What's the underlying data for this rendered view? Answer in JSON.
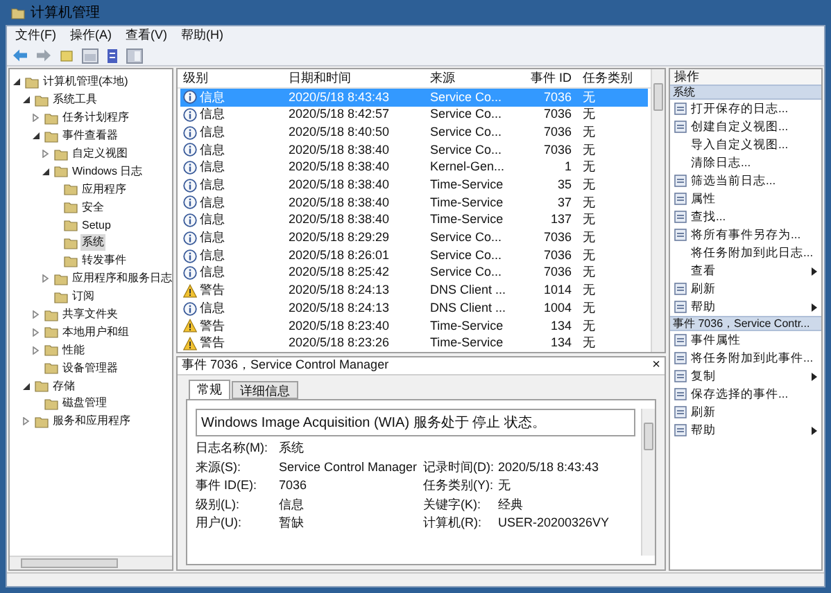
{
  "window": {
    "title": "计算机管理"
  },
  "menu": [
    "文件(F)",
    "操作(A)",
    "查看(V)",
    "帮助(H)"
  ],
  "tree": [
    {
      "label": "计算机管理(本地)",
      "expanded": true,
      "selected": false,
      "children": [
        {
          "label": "系统工具",
          "expanded": true,
          "selected": false,
          "children": [
            {
              "label": "任务计划程序",
              "expanded": false,
              "selected": false
            },
            {
              "label": "事件查看器",
              "expanded": true,
              "selected": false,
              "children": [
                {
                  "label": "自定义视图",
                  "expanded": false,
                  "selected": false
                },
                {
                  "label": "Windows 日志",
                  "expanded": true,
                  "selected": false,
                  "children": [
                    {
                      "label": "应用程序",
                      "selected": false
                    },
                    {
                      "label": "安全",
                      "selected": false
                    },
                    {
                      "label": "Setup",
                      "selected": false
                    },
                    {
                      "label": "系统",
                      "selected": true
                    },
                    {
                      "label": "转发事件",
                      "selected": false
                    }
                  ]
                },
                {
                  "label": "应用程序和服务日志",
                  "expanded": false,
                  "selected": false
                },
                {
                  "label": "订阅",
                  "selected": false
                }
              ]
            },
            {
              "label": "共享文件夹",
              "expanded": false,
              "selected": false
            },
            {
              "label": "本地用户和组",
              "expanded": false,
              "selected": false
            },
            {
              "label": "性能",
              "expanded": false,
              "selected": false
            },
            {
              "label": "设备管理器",
              "selected": false
            }
          ]
        },
        {
          "label": "存储",
          "expanded": true,
          "selected": false,
          "children": [
            {
              "label": "磁盘管理",
              "selected": false
            }
          ]
        },
        {
          "label": "服务和应用程序",
          "expanded": false,
          "selected": false
        }
      ]
    }
  ],
  "table": {
    "columns": [
      "级别",
      "日期和时间",
      "来源",
      "事件 ID",
      "任务类别"
    ],
    "rows": [
      {
        "kind": "info",
        "level": "信息",
        "time": "2020/5/18 8:43:43",
        "source": "Service Co...",
        "id": "7036",
        "category": "无",
        "selected": true
      },
      {
        "kind": "info",
        "level": "信息",
        "time": "2020/5/18 8:42:57",
        "source": "Service Co...",
        "id": "7036",
        "category": "无",
        "selected": false
      },
      {
        "kind": "info",
        "level": "信息",
        "time": "2020/5/18 8:40:50",
        "source": "Service Co...",
        "id": "7036",
        "category": "无",
        "selected": false
      },
      {
        "kind": "info",
        "level": "信息",
        "time": "2020/5/18 8:38:40",
        "source": "Service Co...",
        "id": "7036",
        "category": "无",
        "selected": false
      },
      {
        "kind": "info",
        "level": "信息",
        "time": "2020/5/18 8:38:40",
        "source": "Kernel-Gen...",
        "id": "1",
        "category": "无",
        "selected": false
      },
      {
        "kind": "info",
        "level": "信息",
        "time": "2020/5/18 8:38:40",
        "source": "Time-Service",
        "id": "35",
        "category": "无",
        "selected": false
      },
      {
        "kind": "info",
        "level": "信息",
        "time": "2020/5/18 8:38:40",
        "source": "Time-Service",
        "id": "37",
        "category": "无",
        "selected": false
      },
      {
        "kind": "info",
        "level": "信息",
        "time": "2020/5/18 8:38:40",
        "source": "Time-Service",
        "id": "137",
        "category": "无",
        "selected": false
      },
      {
        "kind": "info",
        "level": "信息",
        "time": "2020/5/18 8:29:29",
        "source": "Service Co...",
        "id": "7036",
        "category": "无",
        "selected": false
      },
      {
        "kind": "info",
        "level": "信息",
        "time": "2020/5/18 8:26:01",
        "source": "Service Co...",
        "id": "7036",
        "category": "无",
        "selected": false
      },
      {
        "kind": "info",
        "level": "信息",
        "time": "2020/5/18 8:25:42",
        "source": "Service Co...",
        "id": "7036",
        "category": "无",
        "selected": false
      },
      {
        "kind": "warning",
        "level": "警告",
        "time": "2020/5/18 8:24:13",
        "source": "DNS Client ...",
        "id": "1014",
        "category": "无",
        "selected": false
      },
      {
        "kind": "info",
        "level": "信息",
        "time": "2020/5/18 8:24:13",
        "source": "DNS Client ...",
        "id": "1004",
        "category": "无",
        "selected": false
      },
      {
        "kind": "warning",
        "level": "警告",
        "time": "2020/5/18 8:23:40",
        "source": "Time-Service",
        "id": "134",
        "category": "无",
        "selected": false
      },
      {
        "kind": "warning",
        "level": "警告",
        "time": "2020/5/18 8:23:26",
        "source": "Time-Service",
        "id": "134",
        "category": "无",
        "selected": false
      }
    ]
  },
  "detail": {
    "title": "事件 7036，Service Control Manager",
    "close": "×",
    "tabs": [
      {
        "label": "常规",
        "selected": true
      },
      {
        "label": "详细信息",
        "selected": false
      }
    ],
    "message": "Windows Image Acquisition (WIA) 服务处于 停止 状态。",
    "fields": [
      [
        {
          "label": "日志名称(M):",
          "value": "系统"
        }
      ],
      [
        {
          "label": "来源(S):",
          "value": "Service Control Manager"
        },
        {
          "label": "记录时间(D):",
          "value": "2020/5/18 8:43:43"
        }
      ],
      [
        {
          "label": "事件 ID(E):",
          "value": "7036"
        },
        {
          "label": "任务类别(Y):",
          "value": "无"
        }
      ],
      [
        {
          "label": "级别(L):",
          "value": "信息"
        },
        {
          "label": "关键字(K):",
          "value": "经典"
        }
      ],
      [
        {
          "label": "用户(U):",
          "value": "暂缺"
        },
        {
          "label": "计算机(R):",
          "value": "USER-20200326VY"
        }
      ]
    ]
  },
  "actions": {
    "title": "操作",
    "sections": [
      {
        "title": "系统",
        "items": [
          {
            "label": "打开保存的日志...",
            "icon": true,
            "submenu": false
          },
          {
            "label": "创建自定义视图...",
            "icon": true,
            "submenu": false
          },
          {
            "label": "导入自定义视图...",
            "icon": false,
            "submenu": false
          },
          {
            "label": "清除日志...",
            "icon": false,
            "submenu": false
          },
          {
            "label": "筛选当前日志...",
            "icon": true,
            "submenu": false
          },
          {
            "label": "属性",
            "icon": true,
            "submenu": false
          },
          {
            "label": "查找...",
            "icon": true,
            "submenu": false
          },
          {
            "label": "将所有事件另存为...",
            "icon": true,
            "submenu": false
          },
          {
            "label": "将任务附加到此日志...",
            "icon": false,
            "submenu": false
          },
          {
            "label": "查看",
            "icon": false,
            "submenu": true
          },
          {
            "label": "刷新",
            "icon": true,
            "submenu": false
          },
          {
            "label": "帮助",
            "icon": true,
            "submenu": true
          }
        ]
      },
      {
        "title": "事件 7036，Service Contr...",
        "items": [
          {
            "label": "事件属性",
            "icon": true,
            "submenu": false
          },
          {
            "label": "将任务附加到此事件...",
            "icon": true,
            "submenu": false
          },
          {
            "label": "复制",
            "icon": true,
            "submenu": true
          },
          {
            "label": "保存选择的事件...",
            "icon": true,
            "submenu": false
          },
          {
            "label": "刷新",
            "icon": true,
            "submenu": false
          },
          {
            "label": "帮助",
            "icon": true,
            "submenu": true
          }
        ]
      }
    ]
  }
}
